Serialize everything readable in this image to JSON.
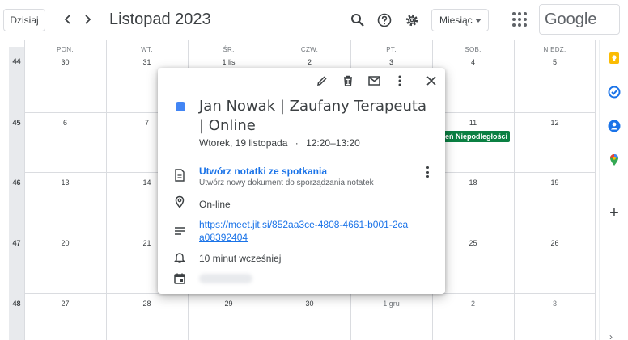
{
  "header": {
    "today_label": "Dzisiaj",
    "month_title": "Listopad 2023",
    "view_label": "Miesiąc",
    "brand": "Google"
  },
  "grid": {
    "weekdays": [
      "PON.",
      "WT.",
      "ŚR.",
      "CZW.",
      "PT.",
      "SOB.",
      "NIEDZ."
    ],
    "weeks": [
      {
        "week": "44",
        "days": [
          "30",
          "31",
          "1 lis",
          "2",
          "3",
          "4",
          "5"
        ]
      },
      {
        "week": "45",
        "days": [
          "6",
          "7",
          "",
          "",
          "",
          "11",
          "12"
        ]
      },
      {
        "week": "46",
        "days": [
          "13",
          "14",
          "",
          "",
          "",
          "18",
          "19"
        ]
      },
      {
        "week": "47",
        "days": [
          "20",
          "21",
          "",
          "",
          "",
          "25",
          "26"
        ]
      },
      {
        "week": "48",
        "days": [
          "27",
          "28",
          "29",
          "30",
          "1 gru",
          "2",
          "3"
        ]
      }
    ],
    "holiday_chip": "eń Niepodległości",
    "holiday_color": "#0b8043"
  },
  "event": {
    "title": "Jan Nowak | Zaufany Terapeuta | Online",
    "date": "Wtorek, 19 listopada",
    "separator": "·",
    "time": "12:20–13:20",
    "color": "#4285f4",
    "notes_link": "Utwórz notatki ze spotkania",
    "notes_sub": "Utwórz nowy dokument do sporządzania notatek",
    "location": "On-line",
    "meet_url": "https://meet.jit.si/852aa3ce-4808-4661-b001-2caa08392404",
    "reminder": "10 minut wcześniej"
  },
  "icons": {
    "edit": "pencil-icon",
    "delete": "trash-icon",
    "email": "mail-icon",
    "more": "more-vertical-icon",
    "close": "close-icon"
  }
}
